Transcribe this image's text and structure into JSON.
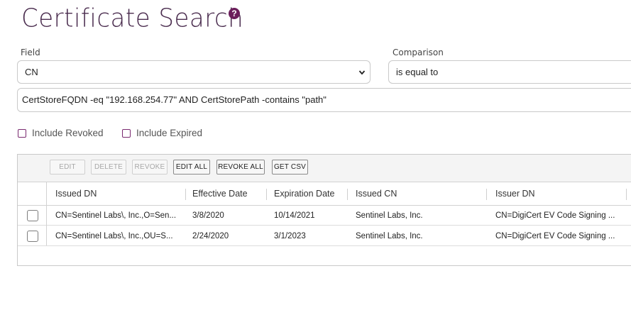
{
  "page": {
    "title": "Certificate Search",
    "help_glyph": "?"
  },
  "filters": {
    "field_label": "Field",
    "field_value": "CN",
    "comparison_label": "Comparison",
    "comparison_value": "is equal to",
    "query": "CertStoreFQDN -eq \"192.168.254.77\" AND CertStorePath -contains \"path\"",
    "include_revoked": {
      "label": "Include Revoked",
      "checked": false
    },
    "include_expired": {
      "label": "Include Expired",
      "checked": false
    }
  },
  "toolbar": {
    "edit": "EDIT",
    "delete": "DELETE",
    "revoke": "REVOKE",
    "edit_all": "EDIT ALL",
    "revoke_all": "REVOKE ALL",
    "get_csv": "GET CSV"
  },
  "table": {
    "columns": [
      "Issued DN",
      "Effective Date",
      "Expiration Date",
      "Issued CN",
      "Issuer DN"
    ],
    "rows": [
      [
        "CN=Sentinel Labs\\, Inc.,O=Sen...",
        "3/8/2020",
        "10/14/2021",
        "Sentinel Labs, Inc.",
        "CN=DigiCert EV Code Signing ..."
      ],
      [
        "CN=Sentinel Labs\\, Inc.,OU=S...",
        "2/24/2020",
        "3/1/2023",
        "Sentinel Labs, Inc.",
        "CN=DigiCert EV Code Signing ..."
      ]
    ]
  },
  "colors": {
    "brand": "#6b1e5b",
    "title": "#4b2d4f",
    "checkbox_border": "#7a2a70"
  },
  "icons": {
    "help": "help-icon",
    "dropdown": "chevron-down-icon"
  }
}
